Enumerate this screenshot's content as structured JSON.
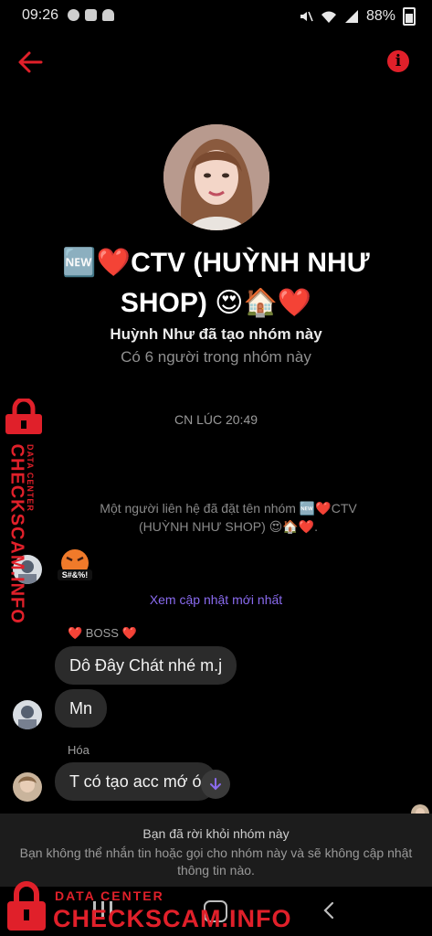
{
  "status_bar": {
    "time": "09:26",
    "battery": "88%"
  },
  "header": {
    "back_icon": "arrow-left-icon",
    "info_icon": "info-icon"
  },
  "group": {
    "name_line1": "🆕❤️CTV (HUỲNH NHƯ",
    "name_line2": "SHOP) 😍🏠❤️",
    "created_by": "Huỳnh Như đã tạo nhóm này",
    "member_count": "Có 6 người trong nhóm này"
  },
  "thread": {
    "timestamp": "CN LÚC 20:49",
    "system_message_line1": "Một người liên hệ đã đặt tên nhóm 🆕❤️CTV",
    "system_message_line2": "(HUỲNH NHƯ SHOP) 😍🏠❤️.",
    "sticker_text": "S#&%!",
    "see_latest": "Xem cập nhật mới nhất",
    "messages": [
      {
        "sender": "❤️ BOSS ❤️",
        "text": "Dô Đây Chát nhé m.j"
      },
      {
        "sender": "",
        "text": "Mn"
      },
      {
        "sender": "Hóa",
        "text": "T có tạo acc mớ  ó"
      }
    ]
  },
  "banner": {
    "title": "Bạn đã rời khỏi nhóm này",
    "body": "Bạn không thể nhắn tin hoặc gọi cho nhóm này và sẽ không cập nhật thông tin nào."
  },
  "watermark": {
    "line1": "DATA CENTER",
    "line2": "CHECKSCAM.INFO"
  },
  "colors": {
    "accent": "#8a6bf0",
    "danger": "#e0202a",
    "bubble": "#2b2b2b"
  }
}
